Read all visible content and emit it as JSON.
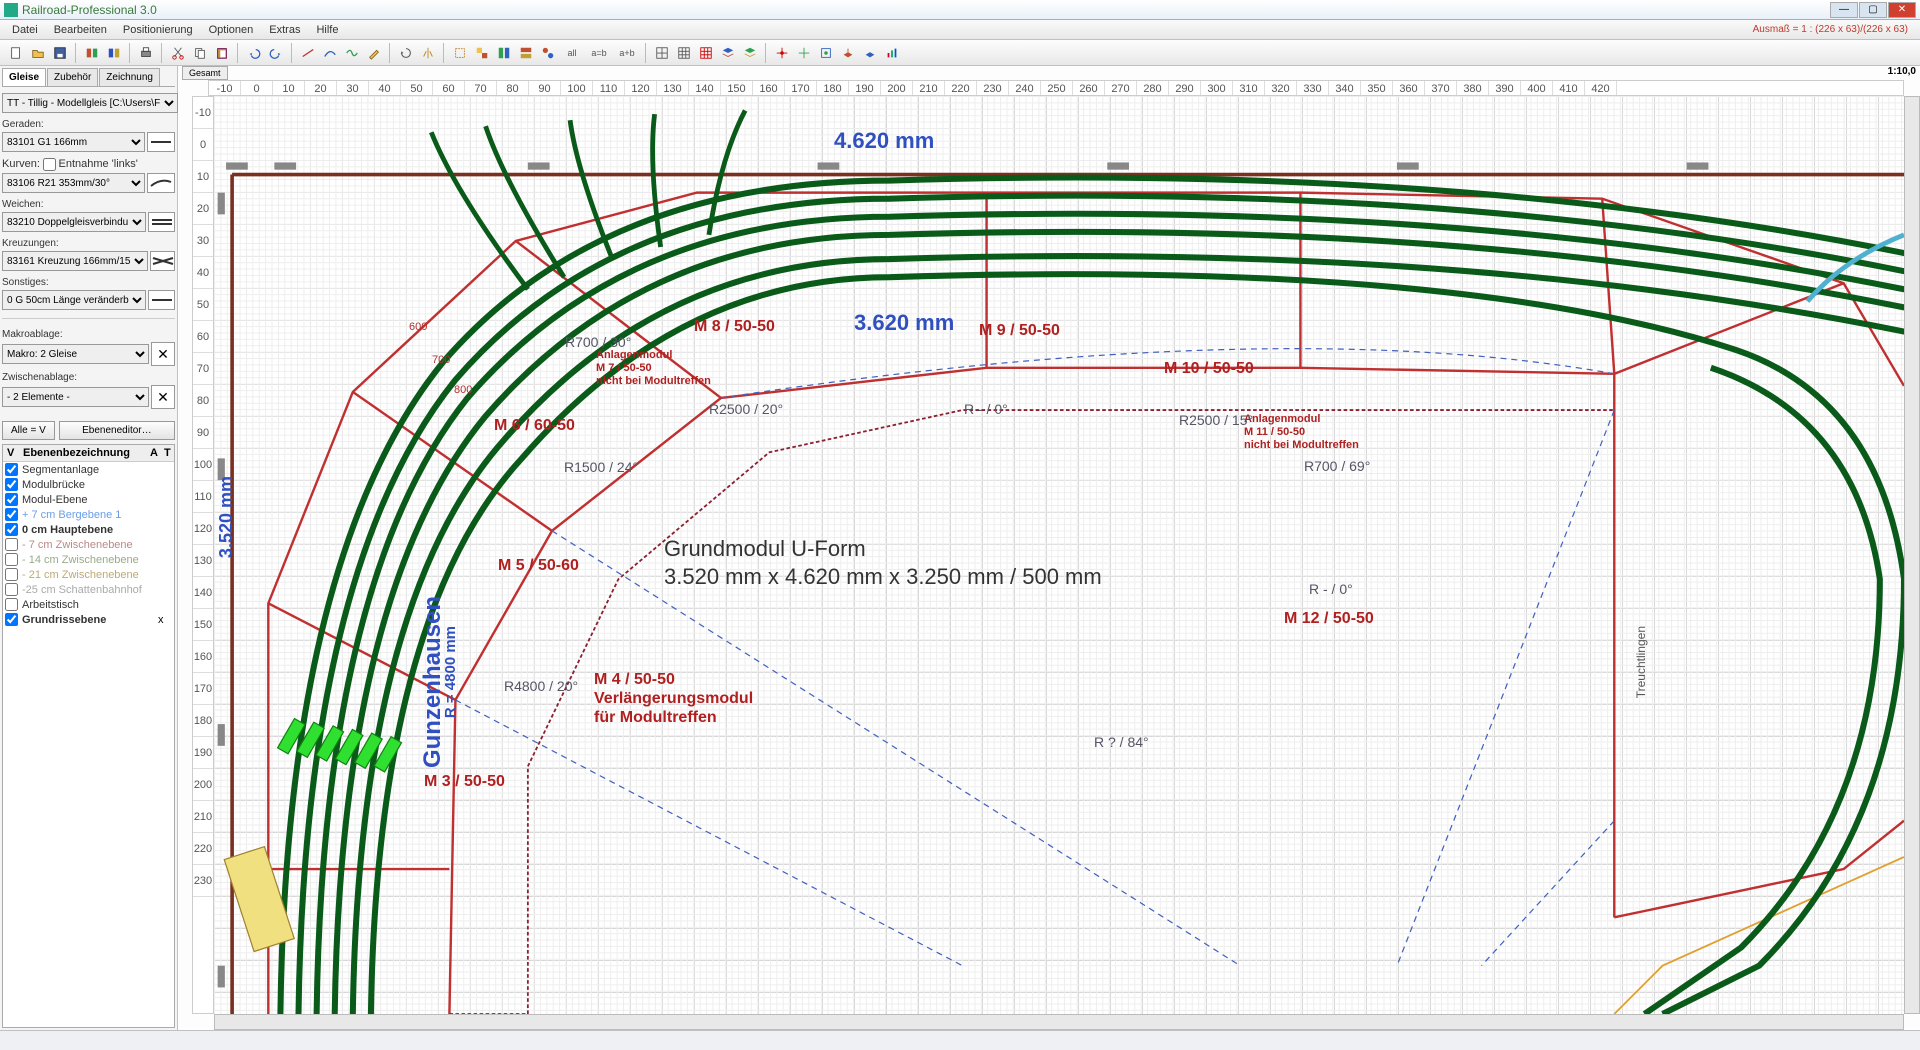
{
  "app": {
    "title": "Railroad-Professional 3.0"
  },
  "menu": [
    "Datei",
    "Bearbeiten",
    "Positionierung",
    "Optionen",
    "Extras",
    "Hilfe"
  ],
  "status_right": "Ausmaß = 1 : (226 x 63)/(226 x 63)",
  "sidebar": {
    "tabs": [
      "Gleise",
      "Zubehör",
      "Zeichnung"
    ],
    "tracklib": "TT - Tillig - Modellgleis   [C:\\Users\\F",
    "geraden_label": "Geraden:",
    "geraden": "83101 G1 166mm",
    "kurven_label": "Kurven:",
    "kurven_cb": "Entnahme 'links'",
    "kurven": "83106 R21 353mm/30°",
    "weichen_label": "Weichen:",
    "weichen": "83210 Doppelgleisverbindu",
    "kreuzungen_label": "Kreuzungen:",
    "kreuzungen": "83161 Kreuzung 166mm/15",
    "sonstiges_label": "Sonstiges:",
    "sonstiges": "0 G 50cm Länge veränderb",
    "makro_label": "Makroablage:",
    "makro": "Makro: 2 Gleise",
    "zwischen_label": "Zwischenablage:",
    "zwischen": "- 2 Elemente -",
    "btn_alle": "Alle = V",
    "btn_ebenen": "Ebeneneditor…",
    "layer_hdr": {
      "v": "V",
      "name": "Ebenenbezeichnung",
      "a": "A",
      "t": "T"
    },
    "layers": [
      {
        "c": true,
        "n": "Segmentanlage",
        "color": "#333"
      },
      {
        "c": true,
        "n": "Modulbrücke",
        "color": "#333"
      },
      {
        "c": true,
        "n": "Modul-Ebene",
        "color": "#333"
      },
      {
        "c": true,
        "n": "+ 7 cm Bergebene 1",
        "color": "#6a9de8"
      },
      {
        "c": true,
        "n": "0 cm Hauptebene",
        "color": "#333",
        "bold": true
      },
      {
        "c": false,
        "n": "- 7 cm Zwischenebene",
        "color": "#b88"
      },
      {
        "c": false,
        "n": "- 14 cm Zwischenebene",
        "color": "#9a8"
      },
      {
        "c": false,
        "n": "- 21 cm Zwischenebene",
        "color": "#ba7"
      },
      {
        "c": false,
        "n": "-25 cm Schattenbahnhof",
        "color": "#aaa"
      },
      {
        "c": false,
        "n": "Arbeitstisch",
        "color": "#333"
      },
      {
        "c": true,
        "n": "Grundrissebene",
        "color": "#333",
        "bold": true,
        "x": "x"
      }
    ]
  },
  "ruler": {
    "scale": "1:10,0",
    "tab": "Gesamt",
    "top": [
      "-10",
      "0",
      "10",
      "20",
      "30",
      "40",
      "50",
      "60",
      "70",
      "80",
      "90",
      "100",
      "110",
      "120",
      "130",
      "140",
      "150",
      "160",
      "170",
      "180",
      "190",
      "200",
      "210",
      "220",
      "230",
      "240",
      "250",
      "260",
      "270",
      "280",
      "290",
      "300",
      "310",
      "320",
      "330",
      "340",
      "350",
      "360",
      "370",
      "380",
      "390",
      "400",
      "410",
      "420"
    ],
    "left": [
      "-10",
      "0",
      "10",
      "20",
      "30",
      "40",
      "50",
      "60",
      "70",
      "80",
      "90",
      "100",
      "110",
      "120",
      "130",
      "140",
      "150",
      "160",
      "170",
      "180",
      "190",
      "200",
      "210",
      "220",
      "230"
    ]
  },
  "labels": {
    "dim_top": "4.620 mm",
    "dim_mid": "3.620 mm",
    "dim_left": "3.520 mm",
    "gunzen": "Gunzenhausen",
    "radius": "R = 4800 mm",
    "treucht": "Treuchtlingen",
    "title1": "Grundmodul U-Form",
    "title2": "3.520 mm x 4.620 mm x 3.250 mm / 500 mm",
    "m3": "M 3 / 50-50",
    "m4a": "M 4 / 50-50",
    "m4b": "Verlängerungsmodul",
    "m4c": "für Modultreffen",
    "m5": "M 5 / 50-60",
    "m6": "M 6 / 60-50",
    "m7a": "Anlagenmodul",
    "m7b": "M 7 / 50-50",
    "m7c": "nicht bei Modultreffen",
    "m8": "M 8 / 50-50",
    "m9": "M 9 / 50-50",
    "m10": "M 10 / 50-50",
    "m11a": "Anlagenmodul",
    "m11b": "M 11 / 50-50",
    "m11c": "nicht bei Modultreffen",
    "m12": "M 12 / 50-50",
    "r700_30": "R700 / 30°",
    "r2500_20": "R2500 / 20°",
    "r_0": "R - / 0°",
    "r2500_15": "R2500 / 15°",
    "r1500_24": "R1500 / 24°",
    "r700_69": "R700 / 69°",
    "r_0b": "R - / 0°",
    "r4800_20": "R4800 / 20°",
    "r_84": "R ? / 84°",
    "d600": "600",
    "d700": "700",
    "d800": "800"
  }
}
